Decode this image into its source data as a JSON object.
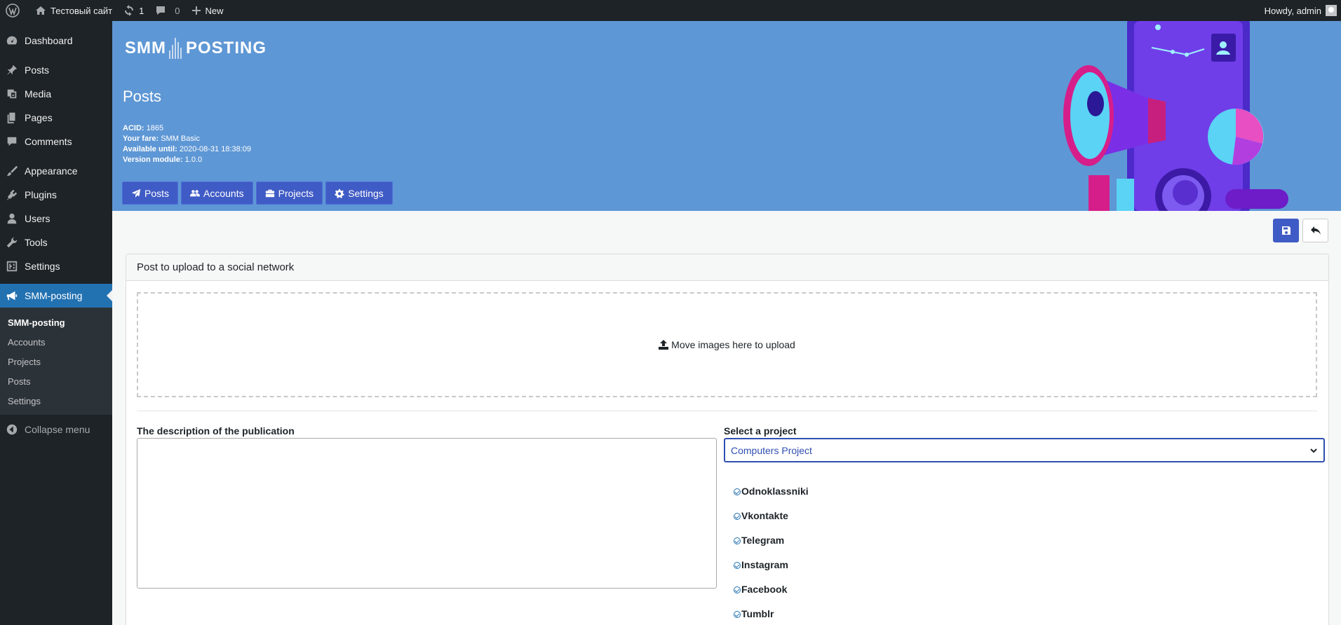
{
  "adminbar": {
    "site_name": "Тестовый сайт",
    "updates_count": "1",
    "comments_count": "0",
    "new_label": "New",
    "howdy": "Howdy, admin"
  },
  "sidebar": {
    "items": [
      {
        "label": "Dashboard",
        "icon": "dashboard-icon"
      },
      {
        "label": "Posts",
        "icon": "pin-icon"
      },
      {
        "label": "Media",
        "icon": "media-icon"
      },
      {
        "label": "Pages",
        "icon": "pages-icon"
      },
      {
        "label": "Comments",
        "icon": "comment-icon"
      },
      {
        "label": "Appearance",
        "icon": "paintbrush-icon"
      },
      {
        "label": "Plugins",
        "icon": "plugin-icon"
      },
      {
        "label": "Users",
        "icon": "user-icon"
      },
      {
        "label": "Tools",
        "icon": "wrench-icon"
      },
      {
        "label": "Settings",
        "icon": "settings-icon"
      },
      {
        "label": "SMM-posting",
        "icon": "megaphone-icon"
      }
    ],
    "submenu": [
      "SMM-posting",
      "Accounts",
      "Projects",
      "Posts",
      "Settings"
    ],
    "collapse_label": "Collapse menu"
  },
  "header": {
    "logo_left": "SMM",
    "logo_right": "POSTING",
    "title": "Posts",
    "acid_label": "ACID:",
    "acid_value": "1865",
    "fare_label": "Your fare:",
    "fare_value": "SMM Basic",
    "until_label": "Available until:",
    "until_value": "2020-08-31 18:38:09",
    "version_label": "Version module:",
    "version_value": "1.0.0",
    "tabs": [
      "Posts",
      "Accounts",
      "Projects",
      "Settings"
    ]
  },
  "card": {
    "title": "Post to upload to a social network",
    "upload_text": "Move images here to upload",
    "description_label": "The description of the publication",
    "description_value": "",
    "project_label": "Select a project",
    "project_selected": "Computers Project",
    "networks": [
      "Odnoklassniki",
      "Vkontakte",
      "Telegram",
      "Instagram",
      "Facebook",
      "Tumblr"
    ]
  },
  "colors": {
    "header_bg": "#5e97d5",
    "button_primary": "#3f5bc5",
    "wp_accent": "#2271b1",
    "wp_dark": "#1d2327"
  }
}
